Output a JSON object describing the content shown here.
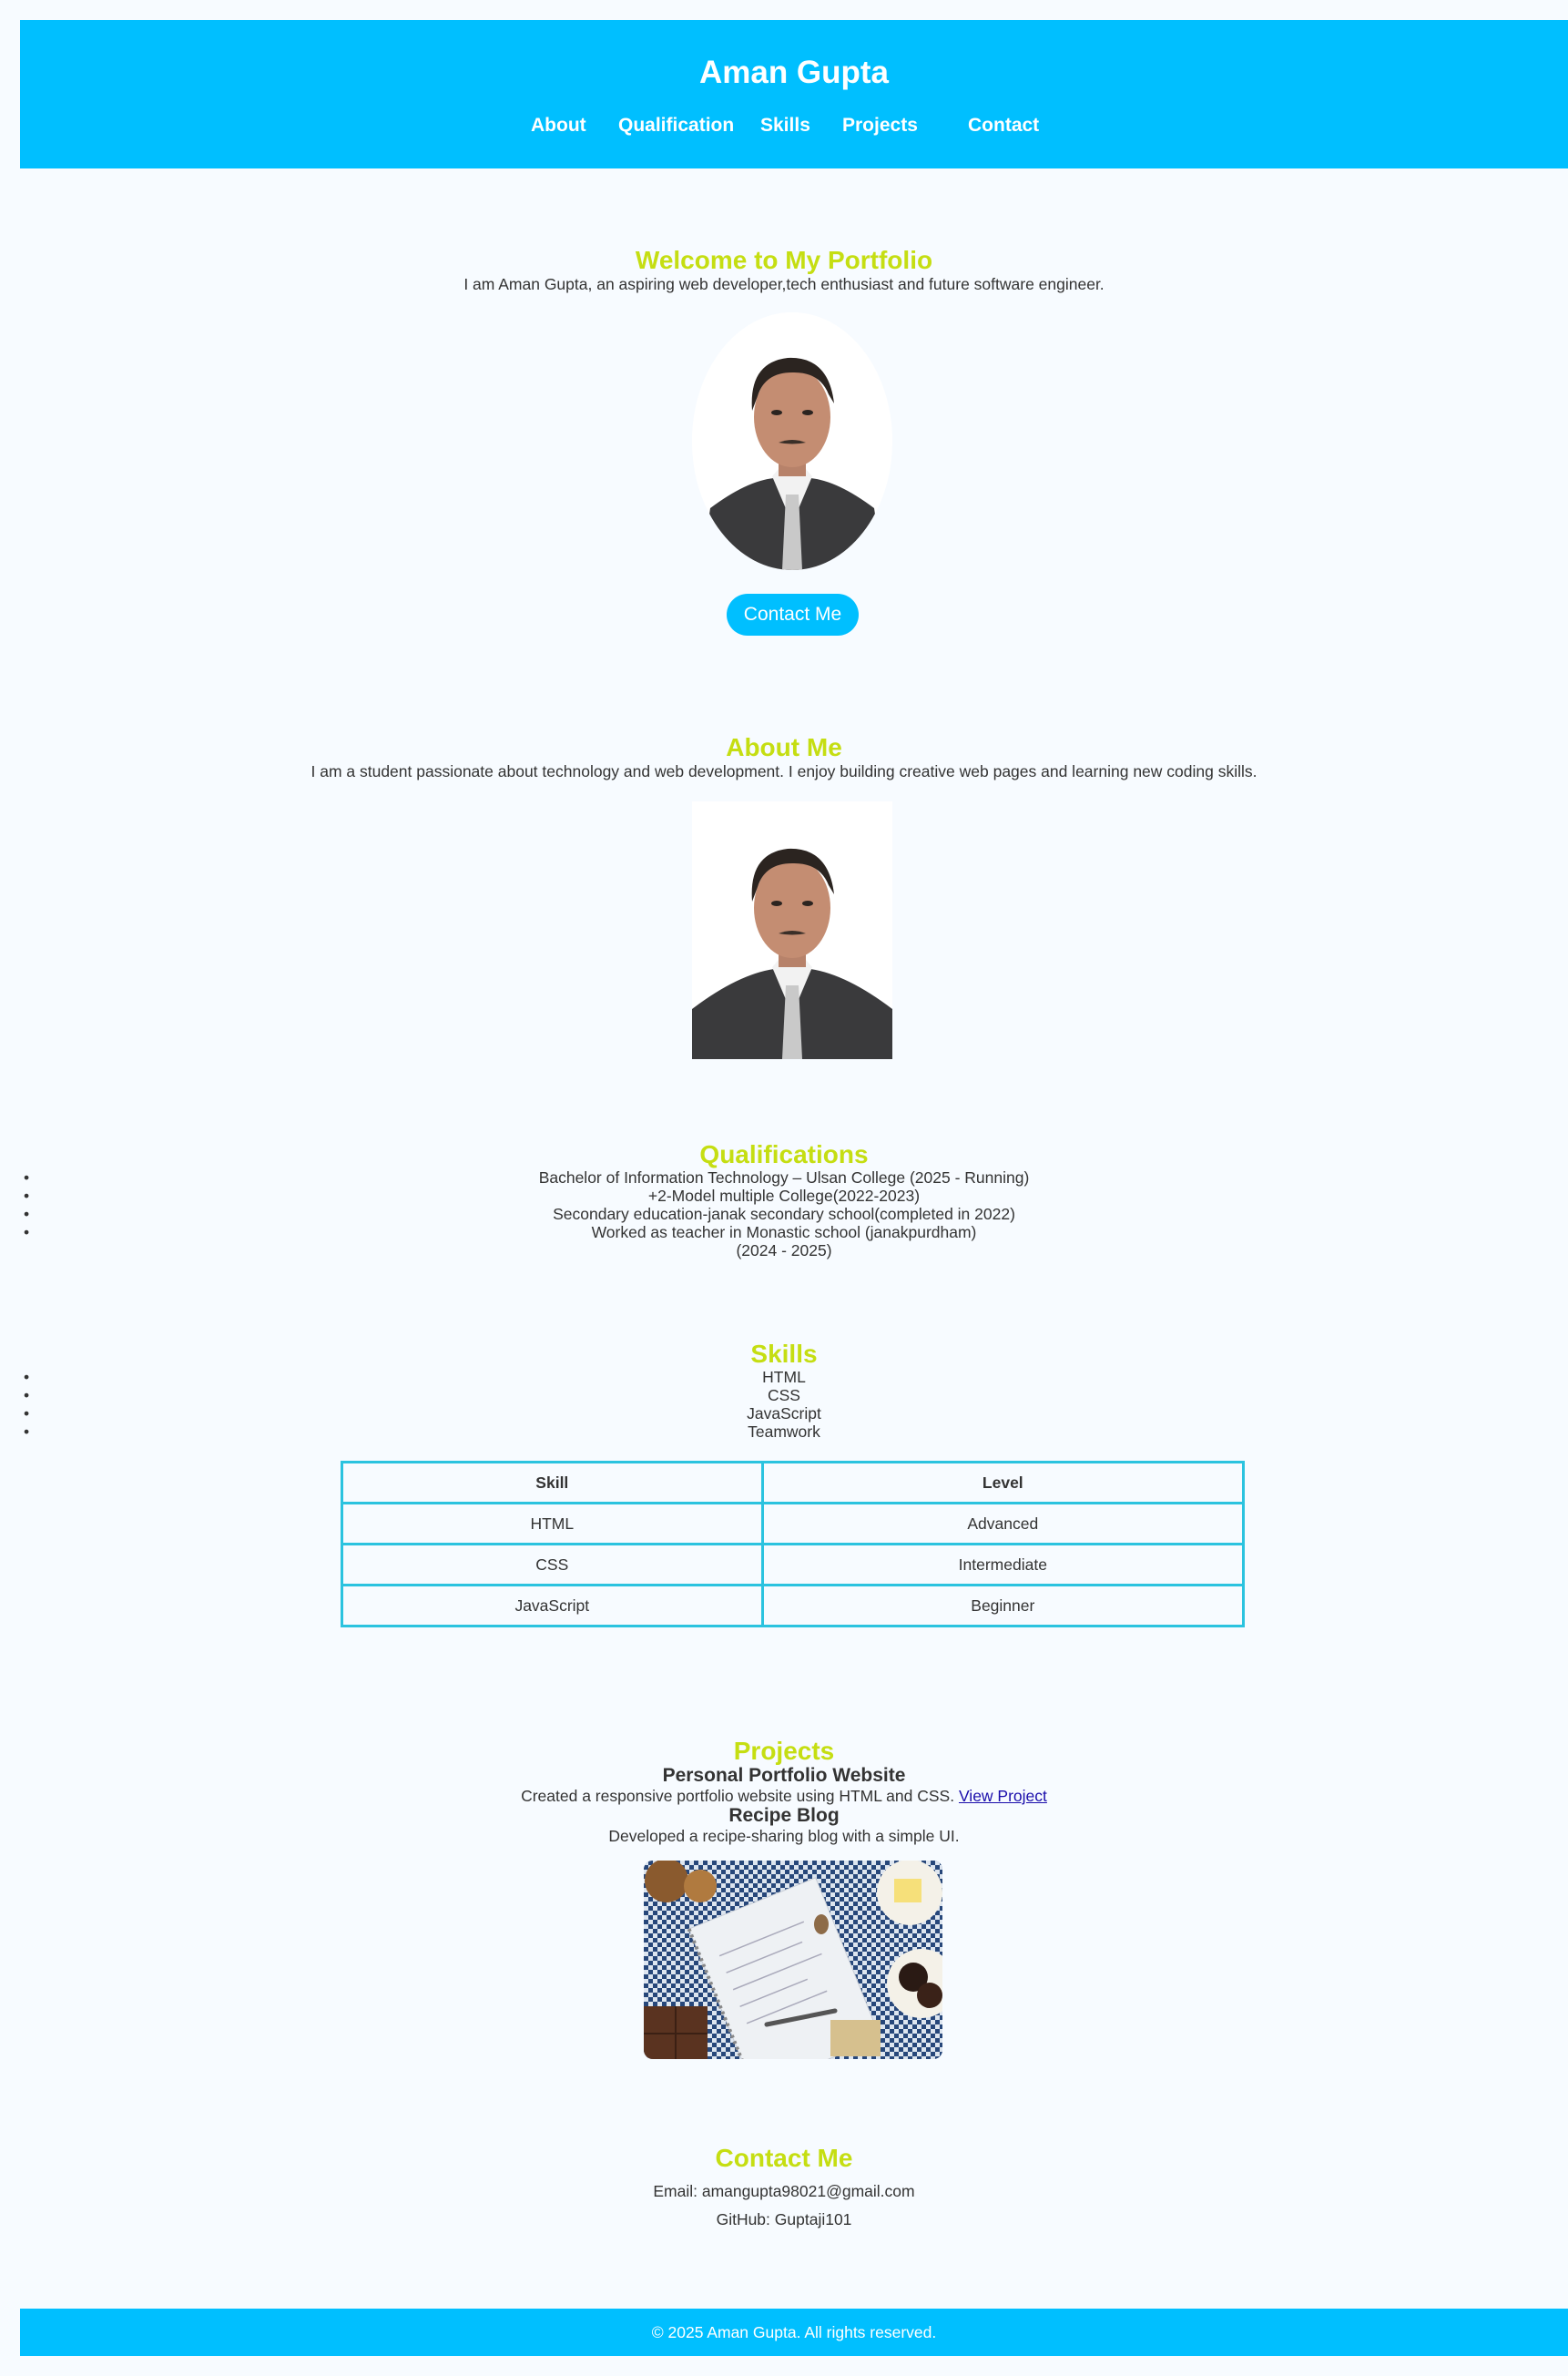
{
  "header": {
    "title": "Aman Gupta",
    "nav": [
      "About",
      "Qualification",
      "Skills",
      "Projects",
      "Contact"
    ]
  },
  "hero": {
    "heading": "Welcome to My Portfolio",
    "intro": "I am Aman Gupta, an aspiring web developer,tech enthusiast and future software engineer.",
    "photo_icon": "profile-photo",
    "button_label": "Contact Me"
  },
  "about": {
    "heading": "About Me",
    "text": "I am a student passionate about technology and web development. I enjoy building creative web pages and learning new coding skills.",
    "photo_icon": "profile-photo"
  },
  "qualifications": {
    "heading": "Qualifications",
    "items": [
      "Bachelor of Information Technology – Ulsan College (2025 - Running)",
      "+2-Model multiple College(2022-2023)",
      "Secondary education-janak secondary school(completed in 2022)",
      "Worked as teacher in Monastic school (janakpurdham)"
    ],
    "extra_line": "(2024 - 2025)"
  },
  "skills": {
    "heading": "Skills",
    "items": [
      "HTML",
      "CSS",
      "JavaScript",
      "Teamwork"
    ],
    "table": {
      "headers": [
        "Skill",
        "Level"
      ],
      "rows": [
        [
          "HTML",
          "Advanced"
        ],
        [
          "CSS",
          "Intermediate"
        ],
        [
          "JavaScript",
          "Beginner"
        ]
      ]
    }
  },
  "projects": {
    "heading": "Projects",
    "items": [
      {
        "title": "Personal Portfolio Website",
        "description": "Created a responsive portfolio website using HTML and CSS.",
        "link_label": "View Project"
      },
      {
        "title": "Recipe Blog",
        "description": "Developed a recipe-sharing blog with a simple UI."
      }
    ],
    "image_icon": "recipe-image"
  },
  "contact": {
    "heading": "Contact Me",
    "email": "Email: amangupta98021@gmail.com",
    "github": "GitHub: Guptaji101"
  },
  "footer": {
    "text": "© 2025 Aman Gupta. All rights reserved."
  },
  "colors": {
    "header_bg": "#00bfff",
    "heading_accent": "#c5de12",
    "page_bg": "#f7fbff",
    "table_border": "#2bc3df"
  }
}
